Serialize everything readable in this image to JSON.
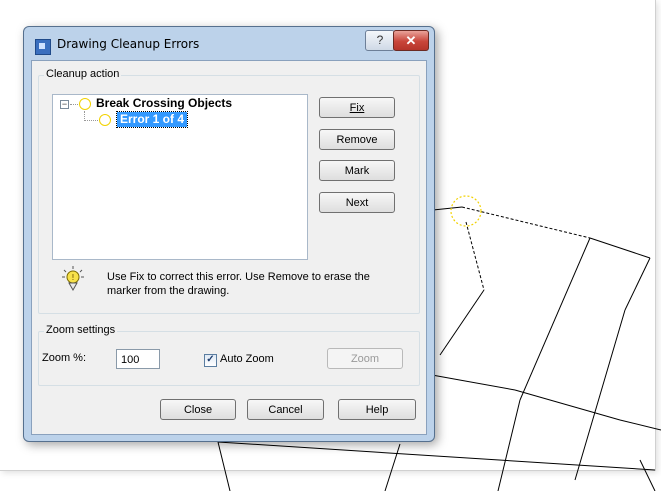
{
  "dialog": {
    "title": "Drawing Cleanup Errors",
    "help_button": "?",
    "close_button": "✕"
  },
  "cleanup": {
    "group_label": "Cleanup action",
    "tree": {
      "root_label": "Break Crossing Objects",
      "child_label": "Error 1 of 4"
    },
    "buttons": {
      "fix": "Fix",
      "remove": "Remove",
      "mark": "Mark",
      "next": "Next"
    },
    "hint": "Use Fix to correct this error. Use Remove to erase the  marker from the drawing."
  },
  "zoom": {
    "group_label": "Zoom settings",
    "zoom_percent_label": "Zoom %:",
    "zoom_percent_value": "100",
    "auto_zoom_label": "Auto Zoom",
    "auto_zoom_checked": true,
    "zoom_button": "Zoom"
  },
  "footer": {
    "close": "Close",
    "cancel": "Cancel",
    "help": "Help"
  },
  "colors": {
    "marker": "#f2d200",
    "selection": "#3399ff",
    "dialog_frame": "#bcd2ea"
  }
}
